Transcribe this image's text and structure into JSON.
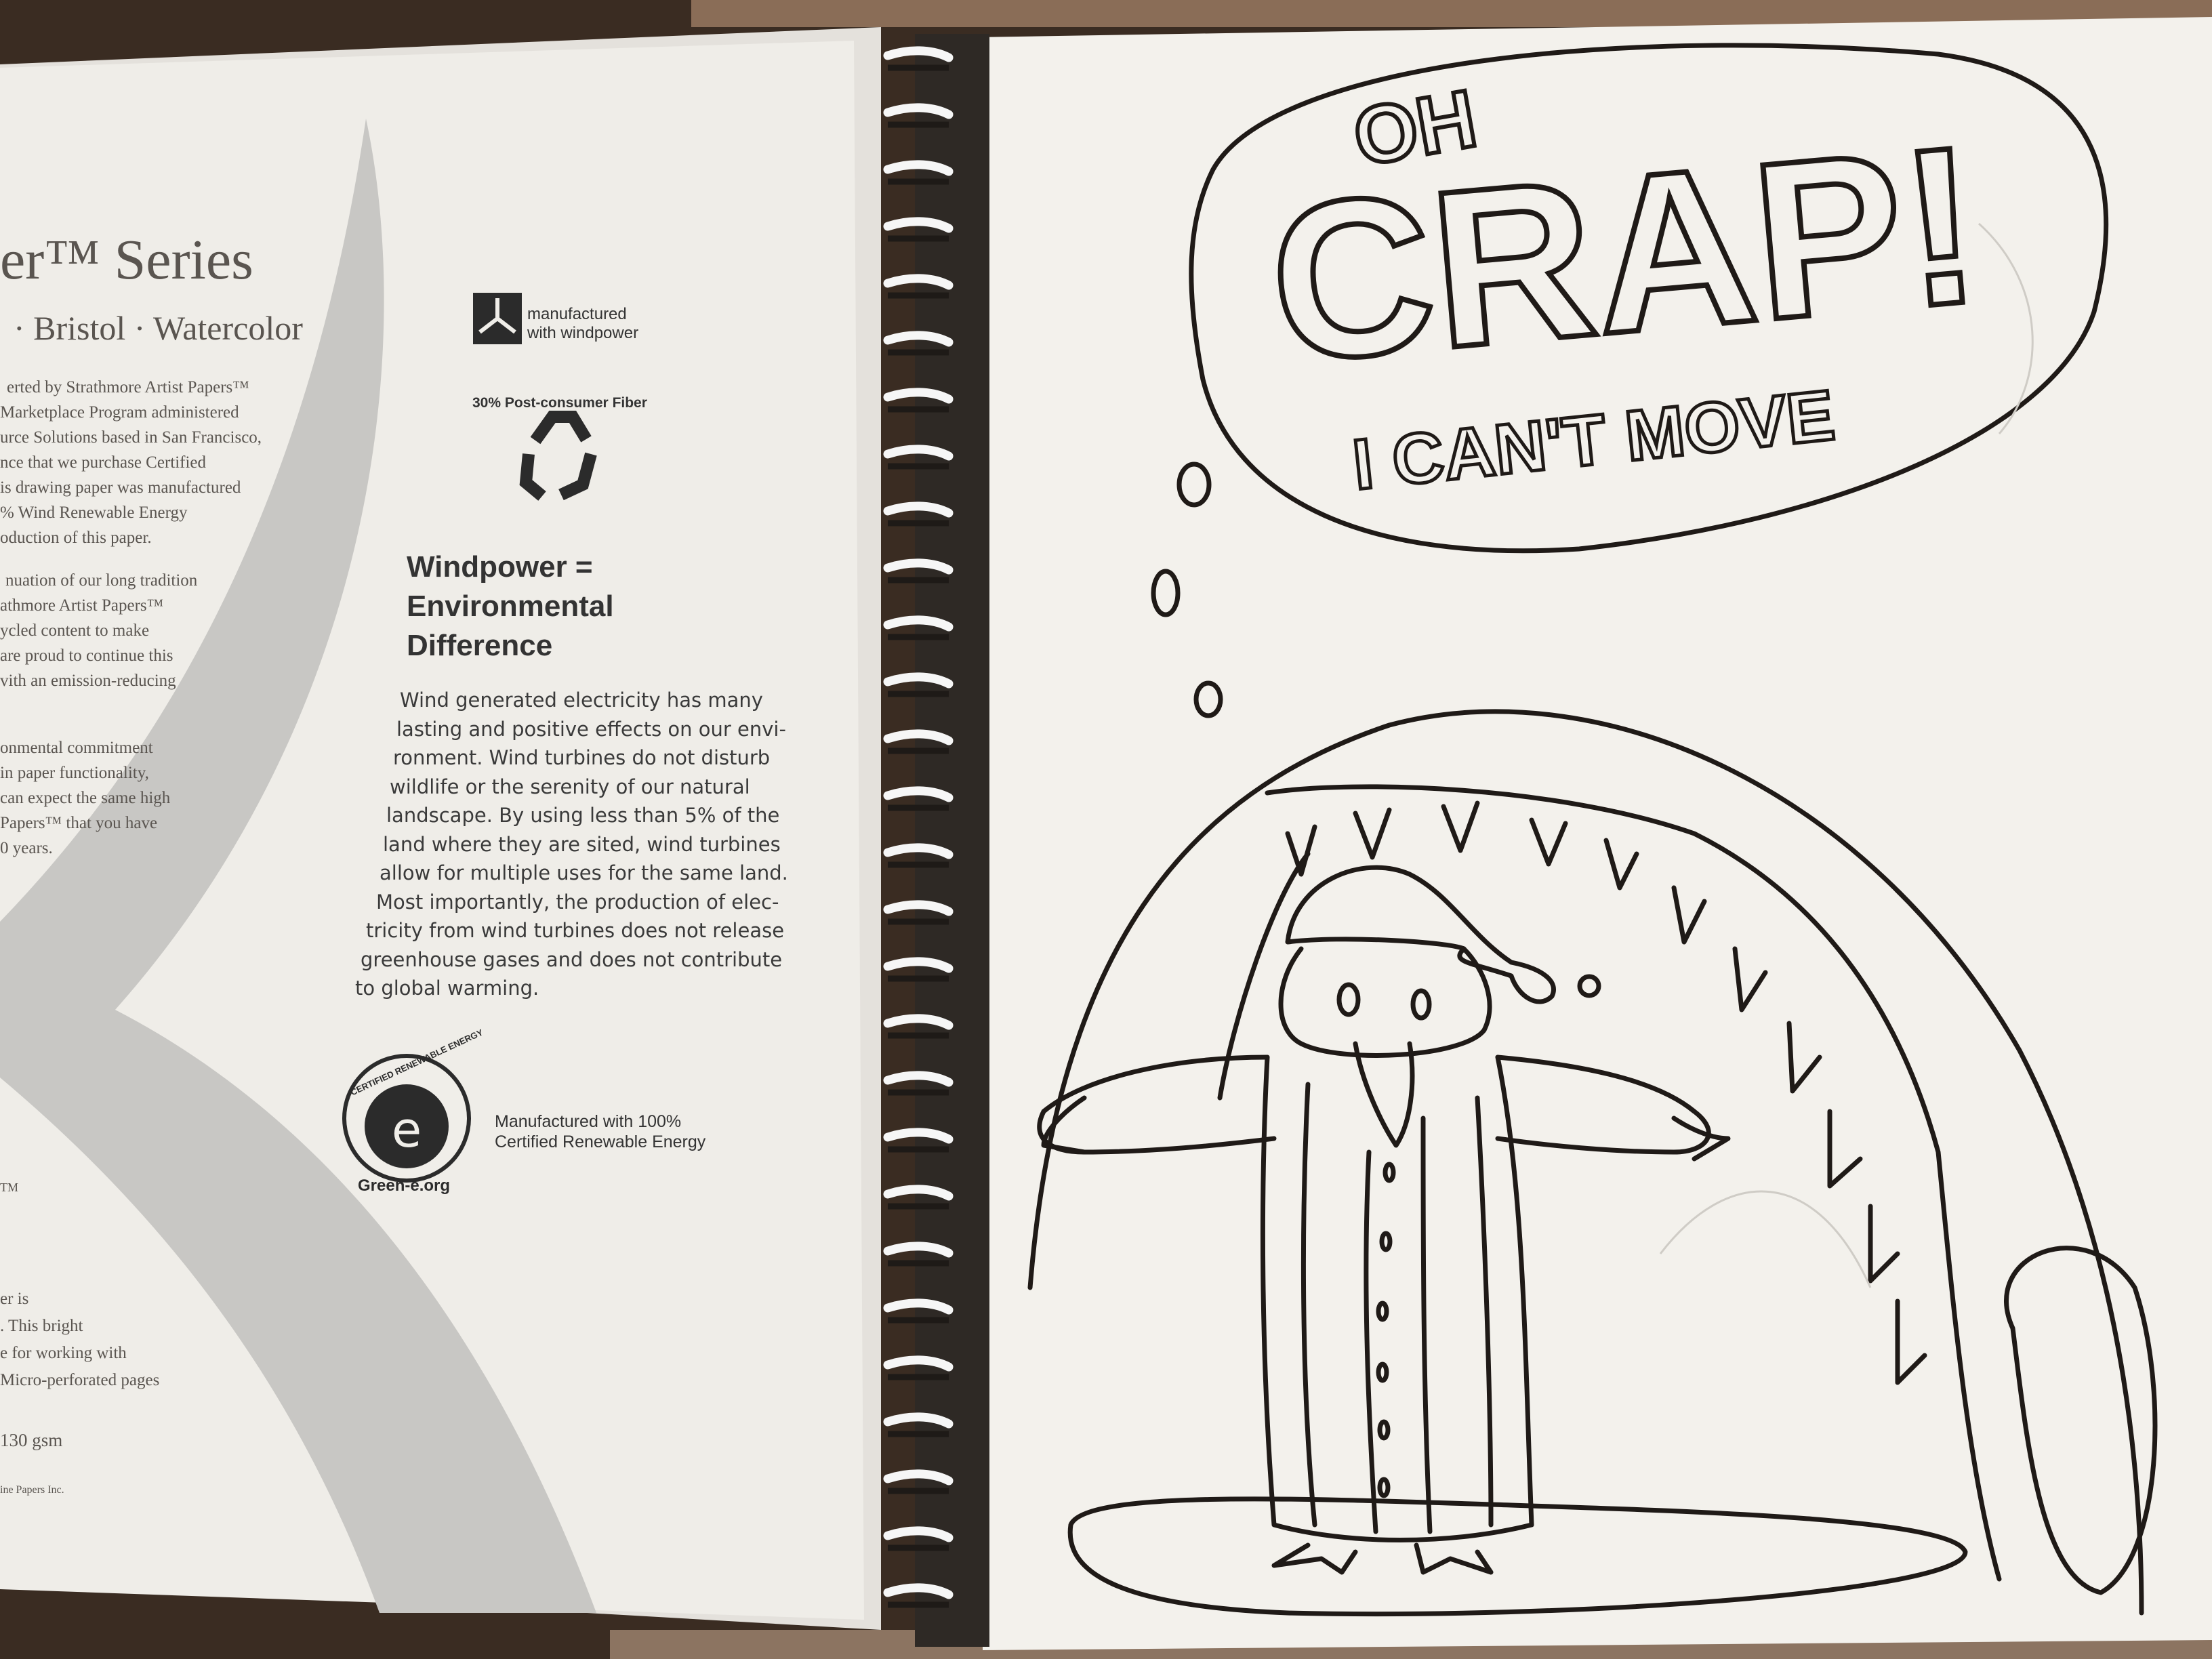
{
  "left_page": {
    "series_title": "er™ Series",
    "series_subtitle": "· Bristol · Watercolor",
    "paragraph_1": [
      "erted by Strathmore Artist Papers™",
      "Marketplace Program administered",
      "urce Solutions based in San Francisco,",
      "nce that we purchase Certified",
      "is drawing paper was manufactured",
      "% Wind Renewable Energy",
      "oduction of this paper."
    ],
    "paragraph_2": [
      "nuation of our long tradition",
      "athmore Artist Papers™",
      "ycled content to make",
      "are proud to continue this",
      "vith an emission-reducing"
    ],
    "paragraph_3": [
      "onmental commitment",
      "in paper functionality,",
      "can expect the same high",
      "Papers™ that you have",
      "0 years."
    ],
    "tm_mark": "TM",
    "paragraph_4": [
      "er is",
      ". This bright",
      "e for working with",
      "Micro-perforated pages"
    ],
    "weight": "130 gsm",
    "copyright": "ine Papers Inc."
  },
  "center_page": {
    "windpower_logo_text": [
      "manufactured",
      "with windpower"
    ],
    "recycled_label": "30% Post-consumer Fiber",
    "headline": [
      "Windpower =",
      "Environmental",
      "Difference"
    ],
    "body": [
      "Wind generated electricity has many",
      "lasting and positive effects on our envi-",
      "ronment. Wind turbines do not disturb",
      "wildlife or the serenity of our natural",
      "landscape. By using less than 5% of the",
      "land where they are sited, wind turbines",
      "allow for multiple uses for the same land.",
      "Most importantly, the production of elec-",
      "tricity from wind turbines does not release",
      "greenhouse gases and does not contribute",
      "to global warming."
    ],
    "green_e_ring": "CERTIFIED RENEWABLE ENERGY",
    "green_e_url": "Green-e.org",
    "green_e_label": [
      "Manufactured with 100%",
      "Certified Renewable Energy"
    ]
  },
  "drawing": {
    "line1": "OH",
    "line2": "CRAP!",
    "line3": "I CAN'T MOVE"
  },
  "colors": {
    "paper": "#f2f0ec",
    "ink": "#1f1a17",
    "gray_swoosh": "#c5c4c2",
    "table": "#3a2c22"
  }
}
